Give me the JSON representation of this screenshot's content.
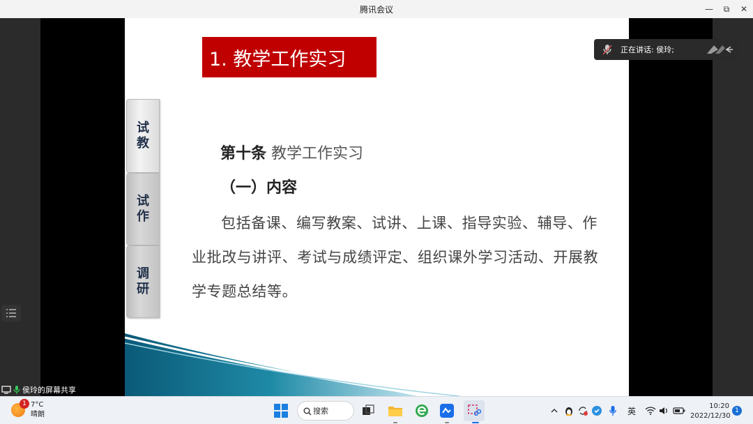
{
  "window": {
    "title": "腾讯会议",
    "minimize": "—",
    "restore": "⧉",
    "close": "✕"
  },
  "slide": {
    "heading": "1. 教学工作实习",
    "tabs": [
      {
        "line1": "试",
        "line2": "教"
      },
      {
        "line1": "试",
        "line2": "作"
      },
      {
        "line1": "调",
        "line2": "研"
      }
    ],
    "article_number": "第十条",
    "article_title": "教学工作实习",
    "section": "（一）内容",
    "body": "包括备课、编写教案、试讲、上课、指导实验、辅导、作业批改与讲评、考试与成绩评定、组织课外学习活动、开展教学专题总结等。"
  },
  "speaking": {
    "label": "正在讲话: 侯玲;"
  },
  "share": {
    "label": "侯玲的屏幕共享"
  },
  "taskbar": {
    "weather_badge": "1",
    "temperature": "7°C",
    "condition": "晴朗",
    "search_label": "搜索",
    "language": "英",
    "time": "10:20",
    "date": "2022/12/30",
    "notification_count": "1"
  },
  "colors": {
    "heading_bg": "#c00000",
    "tab_text": "#23324a",
    "taskbar_bg": "#eef1f6"
  }
}
